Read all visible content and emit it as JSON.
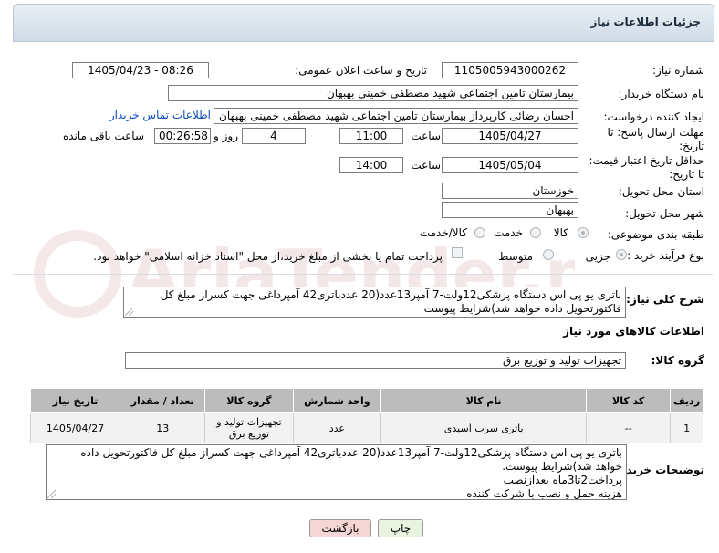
{
  "header": {
    "title": "جزئیات اطلاعات نیاز"
  },
  "fields": {
    "need_number_label": "شماره نیاز:",
    "need_number": "1105005943000262",
    "announce_label": "تاریخ و ساعت اعلان عمومی:",
    "announce_value": "1405/04/23 - 08:26",
    "buyer_org_label": "نام دستگاه خریدار:",
    "buyer_org": "بیمارستان تامین اجتماعی شهید مصطفی خمینی بهبهان",
    "requester_label": "ایجاد کننده درخواست:",
    "requester": "احسان رضائی کارپرداز بیمارستان تامین اجتماعی شهید مصطفی خمینی بهبهان",
    "contact_link": "اطلاعات تماس خریدار",
    "deadline_label_1": "مهلت ارسال پاسخ: تا",
    "deadline_label_2": "تاریخ:",
    "deadline_date": "1405/04/27",
    "time_label": "ساعت",
    "deadline_time": "11:00",
    "days_value": "4",
    "days_label": "روز و",
    "remaining_time": "00:26:58",
    "remaining_label": "ساعت باقی مانده",
    "price_label_1": "حداقل تاریخ اعتبار قیمت:",
    "price_label_2": "تا تاریخ:",
    "price_date": "1405/05/04",
    "price_time_label": "ساعت",
    "price_time": "14:00",
    "province_label": "استان محل تحویل:",
    "province": "خوزستان",
    "city_label": "شهر محل تحویل:",
    "city": "بهبهان",
    "category_label": "طبقه بندی موضوعی:",
    "category_options": [
      "کالا",
      "خدمت",
      "کالا/خدمت"
    ],
    "process_label": "نوع فرآیند خرید :",
    "process_options": [
      "جزیی",
      "متوسط"
    ],
    "payment_note": "پرداخت تمام یا بخشی از مبلغ خرید،از محل \"اسناد خزانه اسلامی\" خواهد بود."
  },
  "description": {
    "label": "شرح کلی نیاز:",
    "text": "باتری یو پی اس دستگاه پزشکی12ولت-7 آمپر13عدد(20 عددباتری42 آمپرداغی جهت کسراز مبلغ کل فاکتورتحویل داده خواهد شد)شرایط پیوست"
  },
  "goods_section": {
    "title": "اطلاعات کالاهای مورد نیاز",
    "group_label": "گروه کالا:",
    "group_value": "تجهیزات تولید و توزیع برق"
  },
  "table": {
    "headers": [
      "ردیف",
      "کد کالا",
      "نام کالا",
      "واحد شمارش",
      "گروه کالا",
      "تعداد / مقدار",
      "تاریخ نیاز"
    ],
    "rows": [
      {
        "row": "1",
        "code": "--",
        "name": "باتری سرب اسیدی",
        "unit": "عدد",
        "group": "تجهیزات تولید و توزیع برق",
        "qty": "13",
        "date": "1405/04/27"
      }
    ]
  },
  "buyer_notes": {
    "label": "توضیحات خریدار:",
    "lines": [
      "باتری یو پی اس دستگاه پزشکی12ولت-7 آمپر13عدد(20 عددباتری42 آمپرداغی جهت کسراز مبلغ کل فاکتورتحویل داده خواهد شد)شرایط پیوست.",
      "پرداخت2تا3ماه بعدازنصب",
      "هزینه حمل و نصب با شرکت کننده"
    ]
  },
  "buttons": {
    "print": "چاپ",
    "back": "بازگشت"
  },
  "watermark": {
    "text": "AriaTender.net"
  },
  "colors": {
    "header_bg": "#cfdbe7",
    "link": "#0b4bbf",
    "back_button": "#f6d5d5",
    "print_button": "#e8f3e0",
    "table_header": "#bcbcbc"
  }
}
